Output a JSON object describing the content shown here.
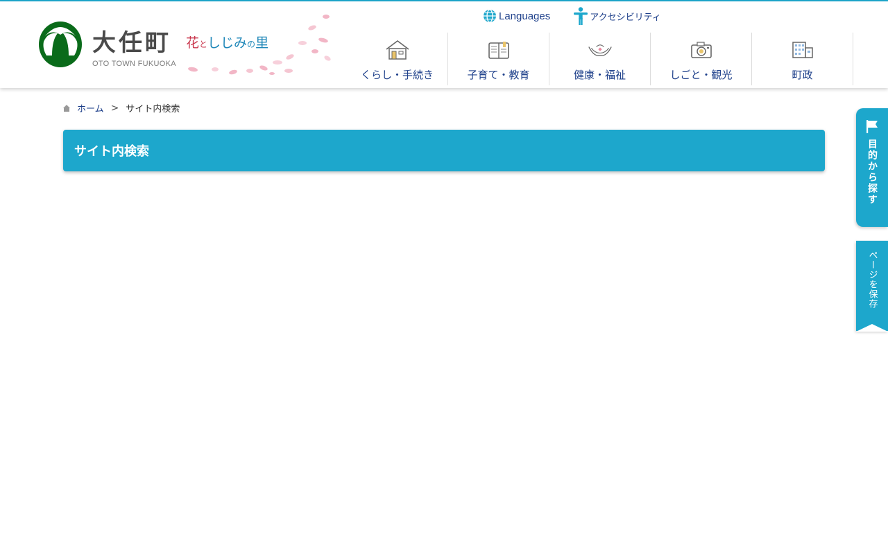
{
  "header": {
    "logo": {
      "title": "大任町",
      "subtitle": "OTO TOWN FUKUOKA",
      "tagline": {
        "part1": "花",
        "part2": "と",
        "part3": "しじみ",
        "part4": "の",
        "part5": "里"
      }
    },
    "utility": {
      "languages_label": "Languages",
      "accessibility_label": "アクセシビリティ"
    },
    "nav": [
      {
        "label": "くらし・手続き",
        "icon": "house-icon"
      },
      {
        "label": "子育て・教育",
        "icon": "book-icon"
      },
      {
        "label": "健康・福祉",
        "icon": "hands-icon"
      },
      {
        "label": "しごと・観光",
        "icon": "camera-icon"
      },
      {
        "label": "町政",
        "icon": "building-icon"
      }
    ]
  },
  "breadcrumb": {
    "home_label": "ホーム",
    "separator": ">",
    "current": "サイト内検索"
  },
  "main": {
    "page_title": "サイト内検索"
  },
  "side_tabs": {
    "purpose_label": "目的から探す",
    "save_label": "ページを保存"
  },
  "colors": {
    "accent": "#1da7cc",
    "nav_text": "#1d3f8a",
    "logo_green": "#0a6b1a",
    "tagline_red": "#c9374d",
    "tagline_blue": "#1d86b8"
  }
}
